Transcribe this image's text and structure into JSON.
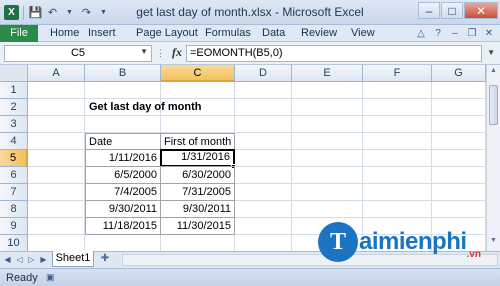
{
  "window": {
    "title": "get last day of month.xlsx - Microsoft Excel",
    "app_icon": "excel-icon"
  },
  "ribbon": {
    "tabs": [
      "File",
      "Home",
      "Insert",
      "Page Layout",
      "Formulas",
      "Data",
      "Review",
      "View"
    ]
  },
  "formula_bar": {
    "name_box": "C5",
    "fx_label": "fx",
    "formula": "=EOMONTH(B5,0)"
  },
  "grid": {
    "columns": [
      "A",
      "B",
      "C",
      "D",
      "E",
      "F",
      "G"
    ],
    "rows": [
      "1",
      "2",
      "3",
      "4",
      "5",
      "6",
      "7",
      "8",
      "9",
      "10"
    ],
    "selected_col": "C",
    "selected_row": "5"
  },
  "sheet": {
    "heading": "Get last day of month",
    "table_headers": [
      "Date",
      "First of month"
    ],
    "table_rows": [
      [
        "1/11/2016",
        "1/31/2016"
      ],
      [
        "6/5/2000",
        "6/30/2000"
      ],
      [
        "7/4/2005",
        "7/31/2005"
      ],
      [
        "9/30/2011",
        "9/30/2011"
      ],
      [
        "11/18/2015",
        "11/30/2015"
      ]
    ]
  },
  "sheet_tabs": [
    "Sheet1"
  ],
  "status_bar": {
    "mode": "Ready"
  },
  "watermark": {
    "logo_letter": "T",
    "text": "aimienphi",
    "tld": ".vn"
  }
}
